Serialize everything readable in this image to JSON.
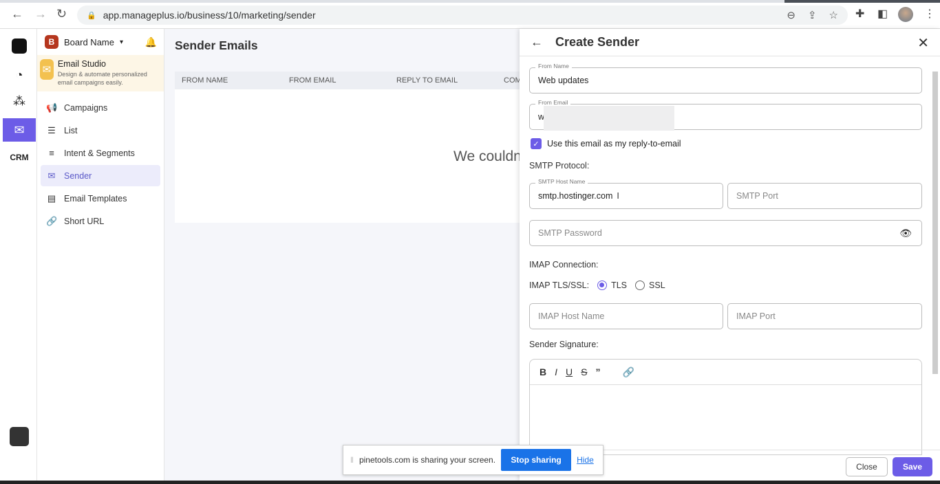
{
  "browser": {
    "url": "app.manageplus.io/business/10/marketing/sender"
  },
  "board": {
    "name": "Board Name"
  },
  "studio": {
    "title": "Email Studio",
    "desc": "Design & automate personalized email campaigns easily."
  },
  "menu": [
    {
      "label": "Campaigns",
      "icon": "megaphone-icon"
    },
    {
      "label": "List",
      "icon": "list-icon"
    },
    {
      "label": "Intent & Segments",
      "icon": "segments-icon"
    },
    {
      "label": "Sender",
      "icon": "sender-icon",
      "active": true
    },
    {
      "label": "Email Templates",
      "icon": "template-icon"
    },
    {
      "label": "Short URL",
      "icon": "link-icon"
    }
  ],
  "main": {
    "title": "Sender Emails",
    "columns": [
      "FROM NAME",
      "FROM EMAIL",
      "REPLY TO EMAIL",
      "COM"
    ],
    "empty": "We couldn"
  },
  "drawer": {
    "title": "Create Sender",
    "from_name": {
      "label": "From Name",
      "value": "Web updates"
    },
    "from_email": {
      "label": "From Email",
      "value": "w"
    },
    "reply_checkbox": {
      "label": "Use this email as my reply-to-email",
      "checked": true
    },
    "smtp_title": "SMTP Protocol:",
    "smtp_host": {
      "label": "SMTP Host Name",
      "value": "smtp.hostinger.com"
    },
    "smtp_port": {
      "placeholder": "SMTP Port"
    },
    "smtp_password": {
      "placeholder": "SMTP Password"
    },
    "imap_title": "IMAP Connection:",
    "imap_tls_label": "IMAP TLS/SSL:",
    "imap_options": [
      "TLS",
      "SSL"
    ],
    "imap_selected": "TLS",
    "imap_host": {
      "placeholder": "IMAP Host Name"
    },
    "imap_port": {
      "placeholder": "IMAP Port"
    },
    "signature_title": "Sender Signature:",
    "toolbar": [
      "B",
      "I",
      "U",
      "S",
      "”",
      "🔗"
    ],
    "close": "Close",
    "save": "Save"
  },
  "share_bar": {
    "text": "pinetools.com is sharing your screen.",
    "stop": "Stop sharing",
    "hide": "Hide"
  },
  "colors": {
    "accent": "#6c5ce7",
    "share_blue": "#1a73e8",
    "studio_bg": "#fdf6e6"
  }
}
